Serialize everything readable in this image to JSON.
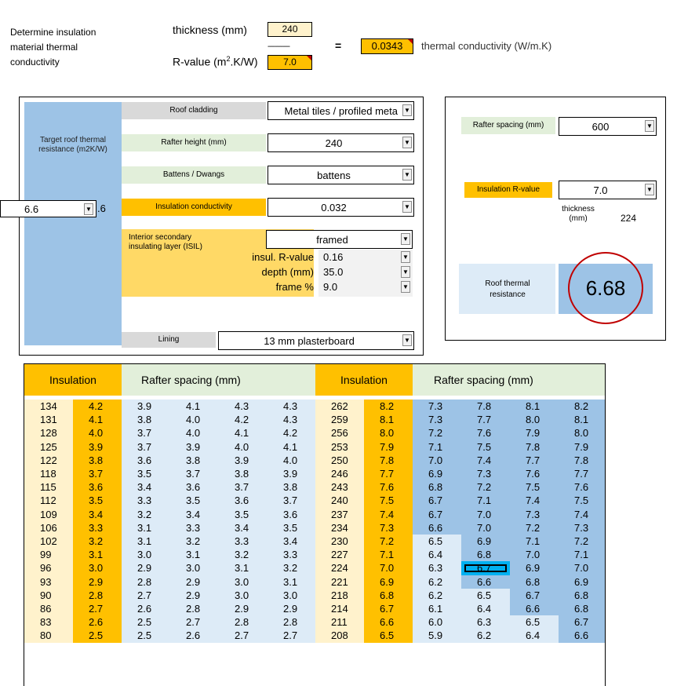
{
  "header": {
    "title_lines": [
      "Determine insulation",
      "material thermal",
      "conductivity"
    ],
    "thickness_label": "thickness (mm)",
    "thickness_value": "240",
    "dashes": "------------",
    "rvalue_label_pre": "R-value (m",
    "rvalue_sup": "2",
    "rvalue_label_post": ".K/W)",
    "rvalue_value": "7.0",
    "equals": "=",
    "conductivity_value": "0.0343",
    "conductivity_label": "thermal conductivity (W/m.K)"
  },
  "calculator": {
    "target_label": "Target roof thermal resistance (m2K/W)",
    "target_dropdown": "6.6",
    "target_suffix": ".6",
    "roof_cladding_label": "Roof cladding",
    "roof_cladding_value": "Metal tiles / profiled meta",
    "rafter_height_label": "Rafter height (mm)",
    "rafter_height_value": "240",
    "battens_label": "Battens / Dwangs",
    "battens_value": "battens",
    "insulation_conductivity_label": "Insulation conductivity",
    "insulation_conductivity_value": "0.032",
    "isil_label": "Interior secondary insulating layer (ISIL)",
    "isil_value": "framed",
    "insul_rvalue_label": "insul. R-value",
    "insul_rvalue_value": "0.16",
    "depth_label": "depth (mm)",
    "depth_value": "35.0",
    "frame_label": "frame %",
    "frame_value": "9.0",
    "lining_label": "Lining",
    "lining_value": "13 mm plasterboard"
  },
  "result_panel": {
    "rafter_spacing_label": "Rafter spacing (mm)",
    "rafter_spacing_value": "600",
    "insulation_rvalue_label": "Insulation R-value",
    "insulation_rvalue_value": "7.0",
    "thickness_label": "thickness (mm)",
    "thickness_value": "224",
    "roof_thermal_label": "Roof thermal resistance",
    "roof_thermal_value": "6.68"
  },
  "table": {
    "left": {
      "insulation_header": "Insulation",
      "spacing_header": "Rafter spacing (mm)",
      "rows": [
        [
          "134",
          "4.2",
          "3.9",
          "4.1",
          "4.3",
          "4.3"
        ],
        [
          "131",
          "4.1",
          "3.8",
          "4.0",
          "4.2",
          "4.3"
        ],
        [
          "128",
          "4.0",
          "3.7",
          "4.0",
          "4.1",
          "4.2"
        ],
        [
          "125",
          "3.9",
          "3.7",
          "3.9",
          "4.0",
          "4.1"
        ],
        [
          "122",
          "3.8",
          "3.6",
          "3.8",
          "3.9",
          "4.0"
        ],
        [
          "118",
          "3.7",
          "3.5",
          "3.7",
          "3.8",
          "3.9"
        ],
        [
          "115",
          "3.6",
          "3.4",
          "3.6",
          "3.7",
          "3.8"
        ],
        [
          "112",
          "3.5",
          "3.3",
          "3.5",
          "3.6",
          "3.7"
        ],
        [
          "109",
          "3.4",
          "3.2",
          "3.4",
          "3.5",
          "3.6"
        ],
        [
          "106",
          "3.3",
          "3.1",
          "3.3",
          "3.4",
          "3.5"
        ],
        [
          "102",
          "3.2",
          "3.1",
          "3.2",
          "3.3",
          "3.4"
        ],
        [
          "99",
          "3.1",
          "3.0",
          "3.1",
          "3.2",
          "3.3"
        ],
        [
          "96",
          "3.0",
          "2.9",
          "3.0",
          "3.1",
          "3.2"
        ],
        [
          "93",
          "2.9",
          "2.8",
          "2.9",
          "3.0",
          "3.1"
        ],
        [
          "90",
          "2.8",
          "2.7",
          "2.9",
          "3.0",
          "3.0"
        ],
        [
          "86",
          "2.7",
          "2.6",
          "2.8",
          "2.9",
          "2.9"
        ],
        [
          "83",
          "2.6",
          "2.5",
          "2.7",
          "2.8",
          "2.8"
        ],
        [
          "80",
          "2.5",
          "2.5",
          "2.6",
          "2.7",
          "2.7"
        ]
      ]
    },
    "right": {
      "insulation_header": "Insulation",
      "spacing_header": "Rafter spacing (mm)",
      "rows": [
        [
          "262",
          "8.2",
          "7.3",
          "7.8",
          "8.1",
          "8.2"
        ],
        [
          "259",
          "8.1",
          "7.3",
          "7.7",
          "8.0",
          "8.1"
        ],
        [
          "256",
          "8.0",
          "7.2",
          "7.6",
          "7.9",
          "8.0"
        ],
        [
          "253",
          "7.9",
          "7.1",
          "7.5",
          "7.8",
          "7.9"
        ],
        [
          "250",
          "7.8",
          "7.0",
          "7.4",
          "7.7",
          "7.8"
        ],
        [
          "246",
          "7.7",
          "6.9",
          "7.3",
          "7.6",
          "7.7"
        ],
        [
          "243",
          "7.6",
          "6.8",
          "7.2",
          "7.5",
          "7.6"
        ],
        [
          "240",
          "7.5",
          "6.7",
          "7.1",
          "7.4",
          "7.5"
        ],
        [
          "237",
          "7.4",
          "6.7",
          "7.0",
          "7.3",
          "7.4"
        ],
        [
          "234",
          "7.3",
          "6.6",
          "7.0",
          "7.2",
          "7.3"
        ],
        [
          "230",
          "7.2",
          "6.5",
          "6.9",
          "7.1",
          "7.2"
        ],
        [
          "227",
          "7.1",
          "6.4",
          "6.8",
          "7.0",
          "7.1"
        ],
        [
          "224",
          "7.0",
          "6.3",
          "6.7",
          "6.9",
          "7.0"
        ],
        [
          "221",
          "6.9",
          "6.2",
          "6.6",
          "6.8",
          "6.9"
        ],
        [
          "218",
          "6.8",
          "6.2",
          "6.5",
          "6.7",
          "6.8"
        ],
        [
          "214",
          "6.7",
          "6.1",
          "6.4",
          "6.6",
          "6.8"
        ],
        [
          "211",
          "6.6",
          "6.0",
          "6.3",
          "6.5",
          "6.7"
        ],
        [
          "208",
          "6.5",
          "5.9",
          "6.2",
          "6.4",
          "6.6"
        ]
      ]
    },
    "selected_cell": {
      "row": 12,
      "col": 3
    },
    "dark_threshold": 6.6
  },
  "colors": {
    "orange": "#ffc000",
    "light_orange": "#ffd966",
    "cream": "#fff2cc",
    "blue": "#9dc3e6",
    "light_blue": "#ddebf7",
    "light_green": "#e2efda",
    "gray": "#d9d9d9",
    "selected": "#00b0f0",
    "circle": "#c00000"
  }
}
